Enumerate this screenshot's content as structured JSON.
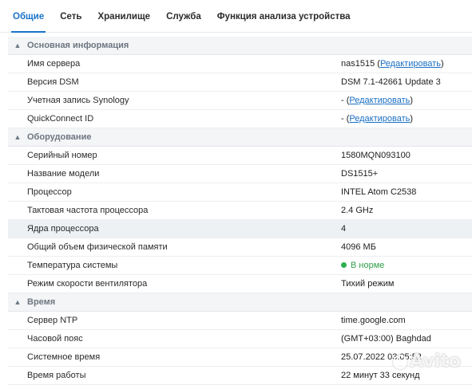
{
  "tabs": [
    "Общие",
    "Сеть",
    "Хранилище",
    "Служба",
    "Функция анализа устройства"
  ],
  "sections": {
    "basic": {
      "title": "Основная информация",
      "server_name": {
        "label": "Имя сервера",
        "value": "nas1515",
        "link": "Редактировать"
      },
      "dsm_version": {
        "label": "Версия DSM",
        "value": "DSM 7.1-42661 Update 3"
      },
      "synology_account": {
        "label": "Учетная запись Synology",
        "value": "-",
        "link": "Редактировать"
      },
      "quickconnect": {
        "label": "QuickConnect ID",
        "value": "-",
        "link": "Редактировать"
      }
    },
    "hardware": {
      "title": "Оборудование",
      "serial": {
        "label": "Серийный номер",
        "value": "1580MQN093100"
      },
      "model": {
        "label": "Название модели",
        "value": "DS1515+"
      },
      "cpu": {
        "label": "Процессор",
        "value": "INTEL Atom C2538"
      },
      "cpu_clock": {
        "label": "Тактовая частота процессора",
        "value": "2.4 GHz"
      },
      "cpu_cores": {
        "label": "Ядра процессора",
        "value": "4"
      },
      "memory": {
        "label": "Общий объем физической памяти",
        "value": "4096 МБ"
      },
      "temperature": {
        "label": "Температура системы",
        "value": "В норме",
        "status_color": "#2eae4f"
      },
      "fan_mode": {
        "label": "Режим скорости вентилятора",
        "value": "Тихий режим"
      }
    },
    "time": {
      "title": "Время",
      "ntp": {
        "label": "Сервер NTP",
        "value": "time.google.com"
      },
      "timezone": {
        "label": "Часовой пояс",
        "value": "(GMT+03:00) Baghdad"
      },
      "system_time": {
        "label": "Системное время",
        "value": "25.07.2022 03:05:52"
      },
      "uptime": {
        "label": "Время работы",
        "value": "22 минут 33 секунд"
      }
    }
  },
  "watermark": "Avito",
  "colors": {
    "accent": "#1a73c9",
    "ok": "#2eae4f"
  }
}
